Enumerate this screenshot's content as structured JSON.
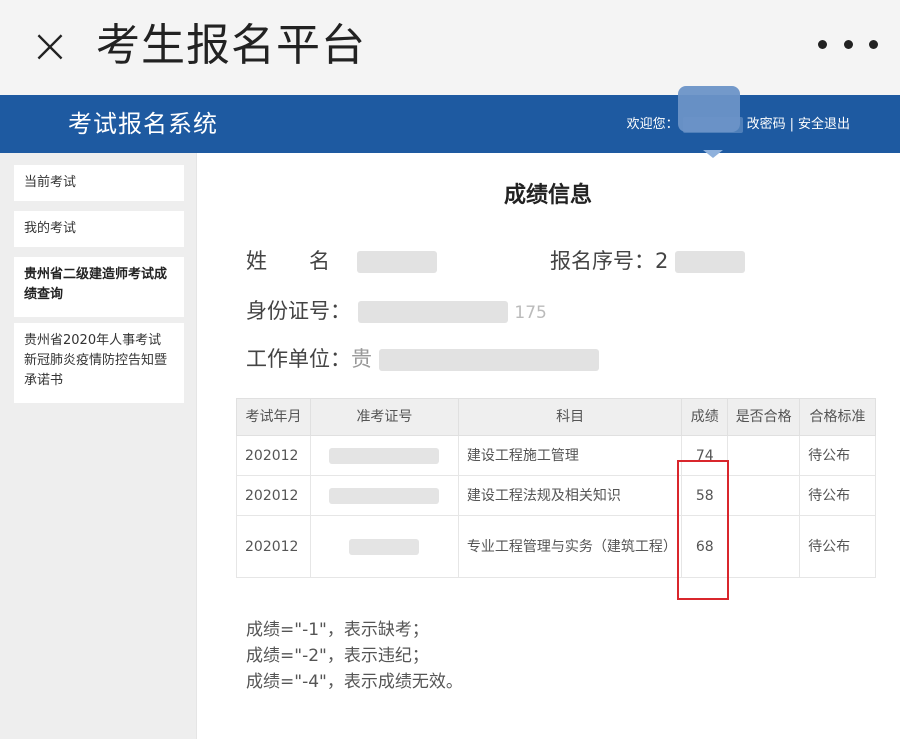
{
  "appbar": {
    "close_symbol": "×",
    "title": "考生报名平台"
  },
  "header": {
    "system_title": "考试报名系统",
    "welcome": "欢迎您：",
    "change_password": "改密码",
    "separator": "|",
    "logout": "安全退出",
    "brand_color": "#1e5aa1"
  },
  "sidebar": {
    "items": [
      {
        "label": "当前考试"
      },
      {
        "label": "我的考试"
      },
      {
        "label": "贵州省二级建造师考试成绩查询"
      },
      {
        "label": "贵州省2020年人事考试新冠肺炎疫情防控告知暨承诺书"
      }
    ]
  },
  "main": {
    "title": "成绩信息",
    "name_label": "姓　　名",
    "reg_no_label": "报名序号：",
    "reg_no_partial": "2",
    "id_label": "身份证号：",
    "id_partial": "175",
    "work_label": "工作单位：",
    "work_partial": "贵",
    "table": {
      "headers": [
        "考试年月",
        "准考证号",
        "科目",
        "成绩",
        "是否合格",
        "合格标准"
      ],
      "rows": [
        {
          "month": "202012",
          "subject": "建设工程施工管理",
          "score": "74",
          "pass": "",
          "standard": "待公布"
        },
        {
          "month": "202012",
          "subject": "建设工程法规及相关知识",
          "score": "58",
          "pass": "",
          "standard": "待公布"
        },
        {
          "month": "202012",
          "subject": "专业工程管理与实务（建筑工程）",
          "score": "68",
          "pass": "",
          "standard": "待公布"
        }
      ]
    },
    "notes": [
      "成绩=\"-1\"，表示缺考；",
      "成绩=\"-2\"，表示违纪；",
      "成绩=\"-4\"，表示成绩无效。"
    ],
    "highlight_color": "#d9262c"
  }
}
